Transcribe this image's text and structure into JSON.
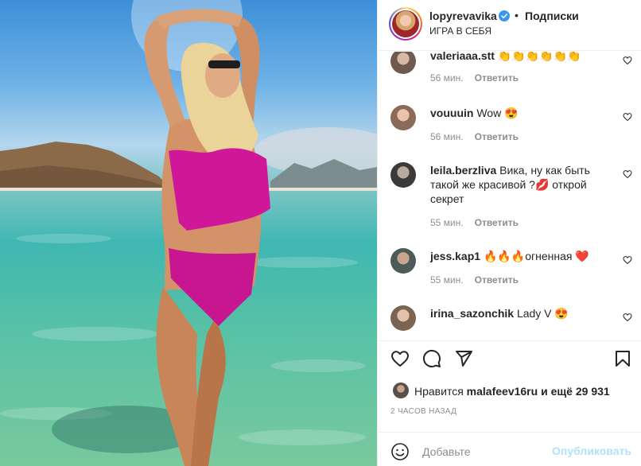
{
  "post": {
    "author": "lopyrevavika",
    "separator": "•",
    "follow_label": "Подписки",
    "subtitle": "ИГРА В СЕБЯ",
    "photo": "woman-in-pink-swimsuit-at-sea"
  },
  "comments": [
    {
      "user": "valeriaaa.stt",
      "text": "👏👏👏👏👏👏",
      "time": "56 мин.",
      "reply": "Ответить"
    },
    {
      "user": "vouuuin",
      "text": "Wow 😍",
      "time": "56 мин.",
      "reply": "Ответить"
    },
    {
      "user": "leila.berzliva",
      "text": "Вика, ну как быть такой же красивой ?💋 открой секрет",
      "time": "55 мин.",
      "reply": "Ответить"
    },
    {
      "user": "jess.kap1",
      "text": "🔥🔥🔥огненная ❤️",
      "time": "55 мин.",
      "reply": "Ответить"
    },
    {
      "user": "irina_sazonchik",
      "text": "Lady V 😍",
      "time": "",
      "reply": ""
    }
  ],
  "actions": {
    "icons": [
      "heart-icon",
      "comment-icon",
      "share-icon",
      "bookmark-icon"
    ]
  },
  "likes": {
    "prefix": "Нравится",
    "user": "malafeev16ru",
    "middle": "и ещё",
    "count": "29 931"
  },
  "timestamp": "2 ЧАСОВ НАЗАД",
  "add_comment": {
    "placeholder": "Добавьте",
    "publish_label": "Опубликовать"
  },
  "colors": {
    "verified": "#3897f0",
    "link_disabled": "#b2dffc",
    "muted": "#8e8e8e",
    "swimsuit": "#d0179a"
  }
}
